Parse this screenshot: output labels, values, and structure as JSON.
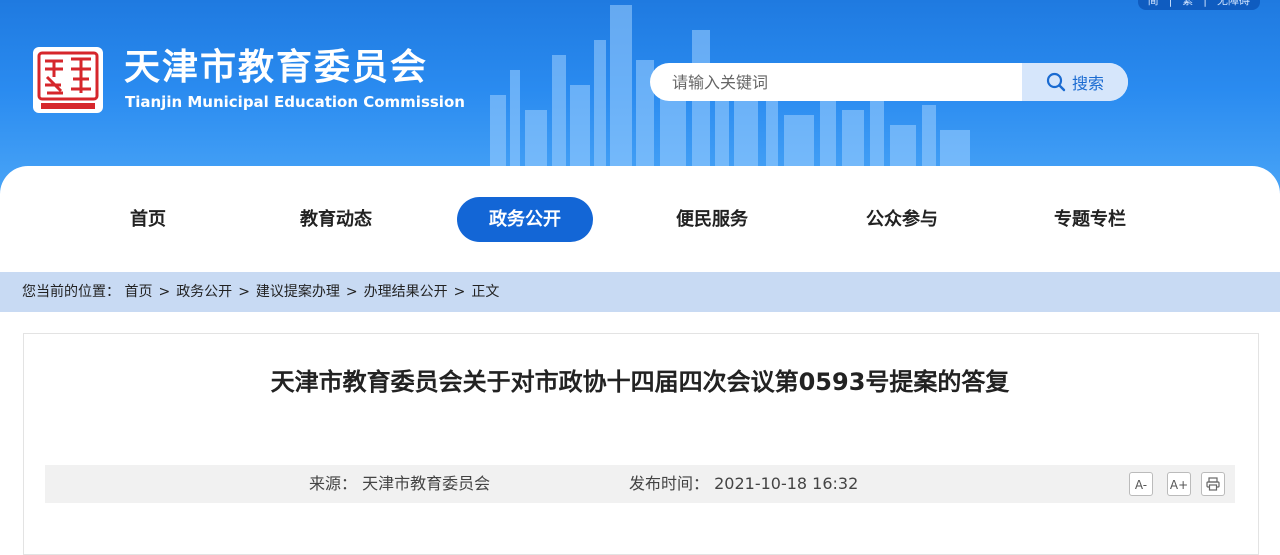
{
  "header": {
    "site_name_cn": "天津市教育委员会",
    "site_name_en": "Tianjin Municipal Education Commission",
    "logo_icon": "tianjin-china-seal",
    "top_links": [
      "简",
      "繁",
      "无障碍"
    ],
    "search": {
      "placeholder": "请输入关键词",
      "button_label": "搜索"
    }
  },
  "nav": {
    "items": [
      {
        "label": "首页"
      },
      {
        "label": "教育动态"
      },
      {
        "label": "政务公开",
        "active": true
      },
      {
        "label": "便民服务"
      },
      {
        "label": "公众参与"
      },
      {
        "label": "专题专栏"
      }
    ]
  },
  "breadcrumb": {
    "prefix": "您当前的位置：",
    "items": [
      "首页",
      "政务公开",
      "建议提案办理",
      "办理结果公开",
      "正文"
    ],
    "separator": ">"
  },
  "article": {
    "title": "天津市教育委员会关于对市政协十四届四次会议第0593号提案的答复",
    "source_label": "来源：",
    "source": "天津市教育委员会",
    "time_label": "发布时间：",
    "time": "2021-10-18 16:32",
    "tools": {
      "decrease_font": "A-",
      "increase_font": "A+",
      "print_icon": "print-icon"
    }
  },
  "colors": {
    "header_blue": "#2a8bf0",
    "nav_active": "#1366d6",
    "breadcrumb_bg": "#c8daf3"
  }
}
